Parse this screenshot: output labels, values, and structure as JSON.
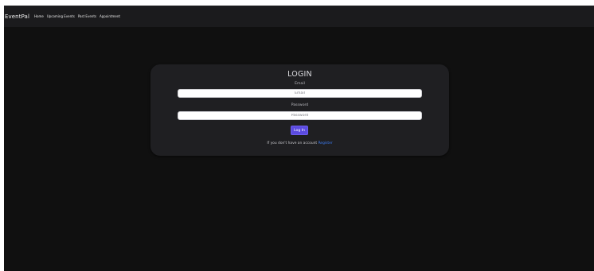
{
  "navbar": {
    "brand": "EventPal",
    "links": [
      "Home",
      "Upcoming Events",
      "Past Events",
      "Appointment"
    ]
  },
  "login": {
    "title": "LOGIN",
    "email_label": "Email",
    "email_placeholder": "Email",
    "email_value": "",
    "password_label": "Password",
    "password_placeholder": "Password",
    "password_value": "",
    "submit_label": "Log In",
    "register_prompt": "If you don't have an account",
    "register_link": "Register"
  },
  "colors": {
    "page_background": "#101010",
    "navbar_background": "#1b1b1d",
    "card_background": "#1f1f22",
    "accent": "#5b4be0",
    "link": "#3d7df5"
  }
}
